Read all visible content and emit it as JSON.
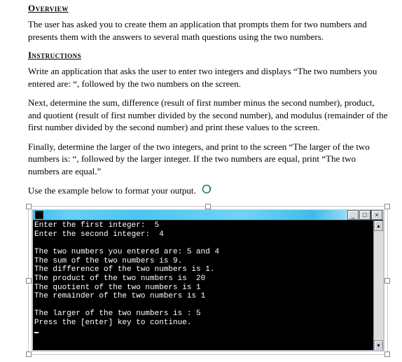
{
  "headings": {
    "overview": "Overview",
    "instructions": "Instructions"
  },
  "paragraphs": {
    "overview_body": "The user has asked you to create them an application that prompts them for two numbers and presents them with the answers to several math questions using the two numbers.",
    "instr1": "Write an application that asks the user to enter two integers and displays “The two numbers you entered are: “, followed by the two numbers on the screen.",
    "instr2": "Next, determine the sum, difference (result of first number minus the second number), product, and quotient (result of first number divided by the second number), and modulus (remainder of the first number divided by the second number) and print these values to the screen.",
    "instr3": "Finally, determine the larger of the two integers, and print to the screen “The larger of the two numbers is: “, followed by the larger integer.   If the two numbers are equal, print “The two numbers are equal.”",
    "instr4": "Use the example below to format your output."
  },
  "console": {
    "minimize": "_",
    "maximize": "□",
    "close": "×",
    "scroll_up": "▴",
    "scroll_down": "▾",
    "lines": {
      "l0": "Enter the first integer:  5",
      "l1": "Enter the second integer:  4",
      "l2": "",
      "l3": "The two numbers you entered are: 5 and 4",
      "l4": "The sum of the two numbers is 9.",
      "l5": "The difference of the two numbers is 1.",
      "l6": "The product of the two numbers is  20",
      "l7": "The quotient of the two numbers is 1",
      "l8": "The remainder of the two numbers is 1",
      "l9": "",
      "l10": "The larger of the two numbers is : 5",
      "l11": "Press the [enter] key to continue."
    }
  }
}
